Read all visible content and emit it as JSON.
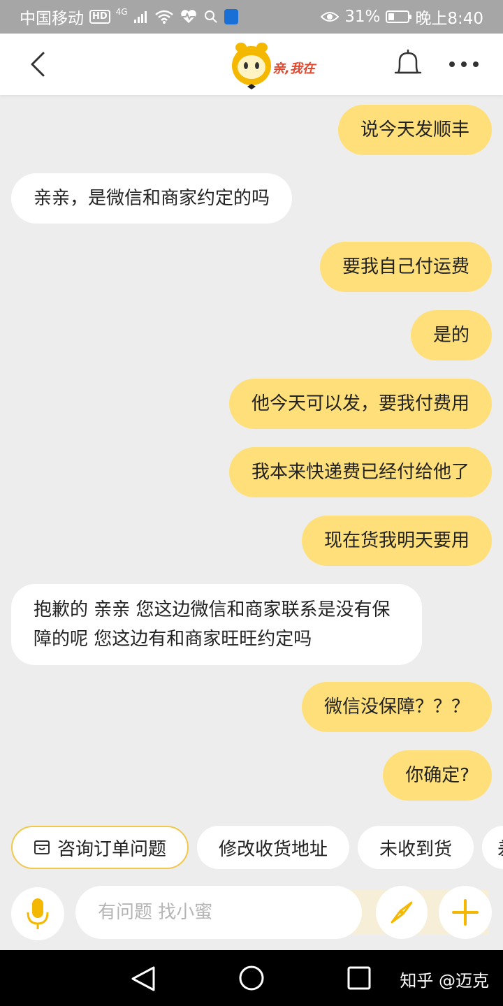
{
  "status_bar": {
    "carrier": "中国移动",
    "hd": "HD",
    "network": "4G",
    "battery_percent": "31%",
    "battery_level": 0.31,
    "time": "晚上8:40"
  },
  "nav": {
    "logo_text": "亲,我在"
  },
  "messages": [
    {
      "side": "right",
      "text": "说今天发顺丰"
    },
    {
      "side": "left",
      "text": "亲亲，是微信和商家约定的吗"
    },
    {
      "side": "right",
      "text": "要我自己付运费"
    },
    {
      "side": "right",
      "text": "是的"
    },
    {
      "side": "right",
      "text": "他今天可以发，要我付费用"
    },
    {
      "side": "right",
      "text": "我本来快递费已经付给他了"
    },
    {
      "side": "right",
      "text": "现在货我明天要用"
    },
    {
      "side": "left",
      "text": "抱歉的 亲亲 您这边微信和商家联系是没有保障的呢 您这边有和商家旺旺约定吗"
    },
    {
      "side": "right",
      "text": "微信没保障？？？"
    },
    {
      "side": "right",
      "text": "你确定?"
    }
  ],
  "quick_replies": [
    "咨询订单问题",
    "修改收货地址",
    "未收到货",
    "差"
  ],
  "input": {
    "placeholder": "有问题 找小蜜"
  },
  "colors": {
    "user_bubble": "#ffdf7a",
    "agent_bubble": "#ffffff",
    "accent": "#f5b800"
  },
  "watermark": "知乎 @迈克"
}
